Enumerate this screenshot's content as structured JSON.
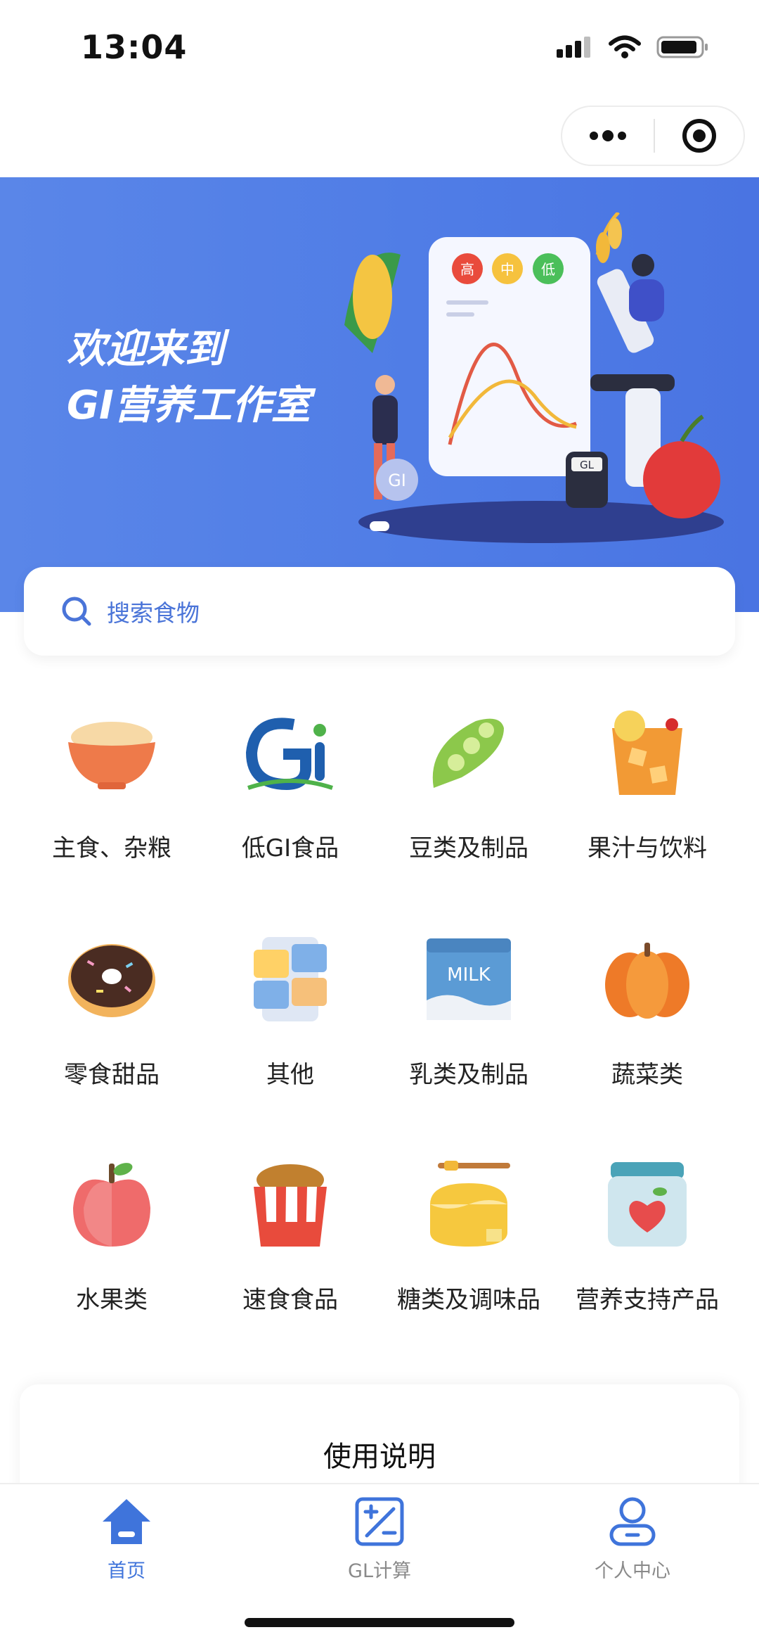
{
  "status": {
    "time": "13:04"
  },
  "banner": {
    "title_line1": "欢迎来到",
    "title_line2": "GI营养工作室",
    "chip_high": "高",
    "chip_mid": "中",
    "chip_low": "低",
    "gi_badge": "GI",
    "gl_badge": "GL"
  },
  "search": {
    "placeholder": "搜索食物"
  },
  "categories": [
    {
      "label": "主食、杂粮",
      "icon": "rice-bowl-icon"
    },
    {
      "label": "低GI食品",
      "icon": "gi-logo-icon"
    },
    {
      "label": "豆类及制品",
      "icon": "soybean-icon"
    },
    {
      "label": "果汁与饮料",
      "icon": "juice-glass-icon"
    },
    {
      "label": "零食甜品",
      "icon": "donut-icon"
    },
    {
      "label": "其他",
      "icon": "misc-foods-icon"
    },
    {
      "label": "乳类及制品",
      "icon": "milk-carton-icon"
    },
    {
      "label": "蔬菜类",
      "icon": "pumpkin-icon"
    },
    {
      "label": "水果类",
      "icon": "apple-icon"
    },
    {
      "label": "速食食品",
      "icon": "fast-food-icon"
    },
    {
      "label": "糖类及调味品",
      "icon": "honey-jar-icon"
    },
    {
      "label": "营养支持产品",
      "icon": "supplement-jar-icon"
    }
  ],
  "milk_text": "MILK",
  "usage": {
    "title": "使用说明"
  },
  "tabbar": {
    "tabs": [
      {
        "label": "首页",
        "icon": "home-icon",
        "active": true
      },
      {
        "label": "GL计算",
        "icon": "calculator-icon",
        "active": false
      },
      {
        "label": "个人中心",
        "icon": "user-icon",
        "active": false
      }
    ]
  },
  "colors": {
    "primary": "#3f74db",
    "banner": "#5081e6",
    "inactive_tab": "#8a8a8a"
  }
}
